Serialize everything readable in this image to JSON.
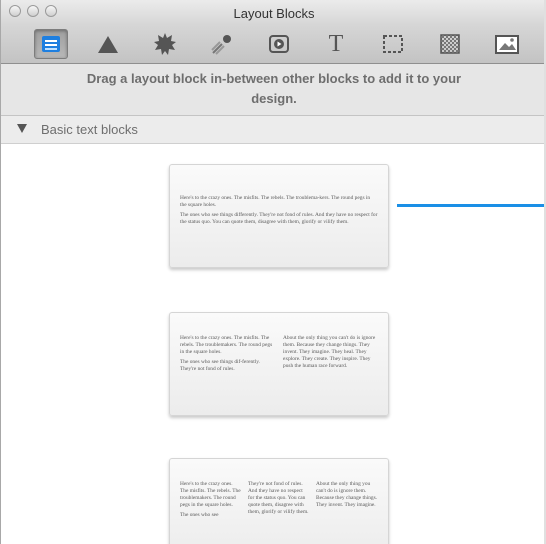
{
  "window": {
    "title": "Layout Blocks"
  },
  "toolbar": {
    "tools": [
      {
        "name": "text-blocks-icon",
        "active": true
      },
      {
        "name": "shape-icon"
      },
      {
        "name": "badge-icon"
      },
      {
        "name": "graphic-icon"
      },
      {
        "name": "media-icon"
      },
      {
        "name": "typography-icon",
        "glyph": "T"
      },
      {
        "name": "selection-icon"
      },
      {
        "name": "pattern-icon"
      },
      {
        "name": "image-icon"
      }
    ]
  },
  "hint": {
    "line1": "Drag a layout block in-between other blocks to add it to your",
    "line2": "design."
  },
  "section": {
    "label": "Basic text blocks"
  },
  "blocks": {
    "one_column": {
      "p1": "Here's to the crazy ones. The misfits. The rebels. The troublema-kers. The round pegs in the square holes.",
      "p2": "The ones who see things differently. They're not fond of rules. And they have no respect for the status quo. You can quote them, disagree with them, glorify or vilify them."
    },
    "two_column": {
      "col1_p1": "Here's to the crazy ones. The misfits. The rebels. The troublemakers. The round pegs in the square holes.",
      "col1_p2": "The ones who see things dif-ferently. They're not fond of rules.",
      "col2_p1": "About the only thing you can't do is ignore them. Because they change things. They invent. They imagine. They heal. They explore. They create. They inspire. They push the human race forward."
    },
    "three_column": {
      "col1_p1": "Here's to the crazy ones. The misfits. The rebels. The troublemakers. The round pegs in the square holes.",
      "col1_p2": "The ones who see",
      "col2_p1": "They're not fond of rules. And they have no respect for the status quo. You can quote them, disagree with them, glorify or vilify them.",
      "col3_p1": "About the only thing you can't do is ignore them. Because they change things. They invent. They imagine."
    }
  },
  "colors": {
    "accent": "#1a8fe6"
  }
}
